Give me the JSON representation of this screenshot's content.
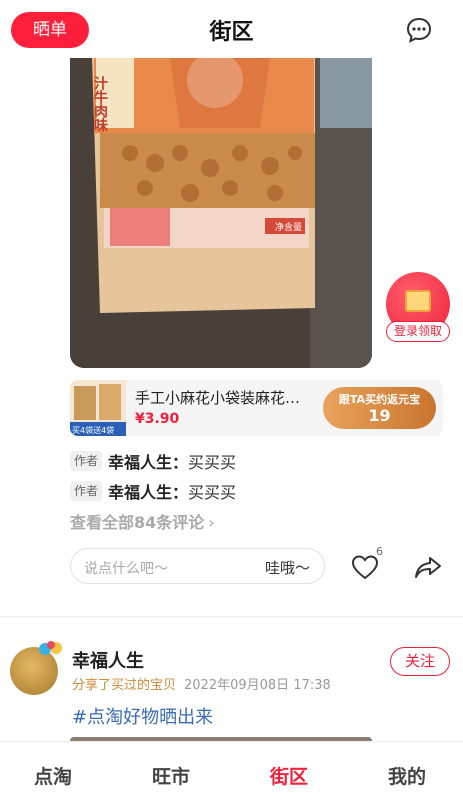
{
  "header": {
    "share_label": "晒单",
    "title": "街区",
    "message_icon": "chat-bubble-icon"
  },
  "photo": {
    "bag_label": "汁牛肉味",
    "net_weight": "净含量"
  },
  "redpacket": {
    "label": "登录领取",
    "icon": "red-envelope-icon"
  },
  "product": {
    "name": "手工小麻花小袋装麻花整箱零食",
    "price": "¥3.90",
    "thumb_badge": "买4袋送4袋",
    "rebate_label": "跟TA买约返元宝",
    "rebate_value": "19"
  },
  "comments": [
    {
      "tag": "作者",
      "author": "幸福人生：",
      "text": "买买买"
    },
    {
      "tag": "作者",
      "author": "幸福人生：",
      "text": "买买买"
    }
  ],
  "view_all": "查看全部84条评论",
  "comment_input": {
    "placeholder": "说点什么吧～",
    "quick_reply": "哇哦～"
  },
  "like_count": "6",
  "next_post": {
    "user_name": "幸福人生",
    "shared_text": "分享了买过的宝贝",
    "time": "2022年09月08日 17:38",
    "follow_label": "关注",
    "topic": "#点淘好物晒出来"
  },
  "tabs": [
    {
      "label": "点淘",
      "active": false
    },
    {
      "label": "旺市",
      "active": false
    },
    {
      "label": "街区",
      "active": true
    },
    {
      "label": "我的",
      "active": false
    }
  ],
  "colors": {
    "accent": "#f0213b",
    "rebate_start": "#e9a35c",
    "rebate_end": "#c9752e",
    "topic": "#3a6bb5"
  }
}
